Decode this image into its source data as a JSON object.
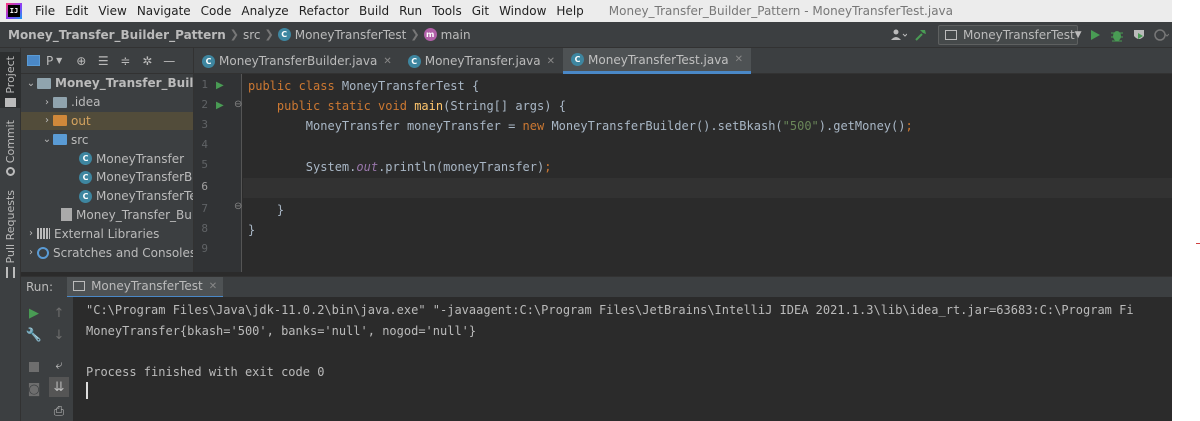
{
  "menubar": {
    "items": [
      "File",
      "Edit",
      "View",
      "Navigate",
      "Code",
      "Analyze",
      "Refactor",
      "Build",
      "Run",
      "Tools",
      "Git",
      "Window",
      "Help"
    ],
    "title": "Money_Transfer_Builder_Pattern - MoneyTransferTest.java"
  },
  "navbar": {
    "project": "Money_Transfer_Builder_Pattern",
    "folder": "src",
    "class": "MoneyTransferTest",
    "method": "main",
    "run_config": "MoneyTransferTest"
  },
  "toolstrip": {
    "project": "Project",
    "commit": "Commit",
    "pull_requests": "Pull Requests"
  },
  "project_panel": {
    "toolbar_label": "P",
    "tree": [
      {
        "label": "Money_Transfer_Builder_P",
        "kind": "project"
      },
      {
        "label": ".idea",
        "kind": "folder"
      },
      {
        "label": "out",
        "kind": "folder-excluded"
      },
      {
        "label": "src",
        "kind": "source-folder"
      },
      {
        "label": "MoneyTransfer",
        "kind": "class"
      },
      {
        "label": "MoneyTransferBuild",
        "kind": "class"
      },
      {
        "label": "MoneyTransferTest",
        "kind": "class"
      },
      {
        "label": "Money_Transfer_Builder",
        "kind": "iml"
      },
      {
        "label": "External Libraries",
        "kind": "libraries"
      },
      {
        "label": "Scratches and Consoles",
        "kind": "scratches"
      }
    ]
  },
  "editor_tabs": [
    {
      "label": "MoneyTransferBuilder.java"
    },
    {
      "label": "MoneyTransfer.java"
    },
    {
      "label": "MoneyTransferTest.java",
      "active": true
    }
  ],
  "editor": {
    "line_numbers": [
      "1",
      "2",
      "3",
      "4",
      "5",
      "6",
      "7",
      "8",
      "9"
    ],
    "current_line": 6,
    "code": {
      "l1": {
        "kw": "public class ",
        "name": "MoneyTransferTest {"
      },
      "l2": {
        "kw": "public static void ",
        "fn": "main",
        "rest": "(String[] args) {"
      },
      "l3": {
        "type": "MoneyTransfer moneyTransfer = ",
        "kw": "new ",
        "call": "MoneyTransferBuilder().setBkash(",
        "str": "\"500\"",
        "end": ").getMoney()",
        "semi": ";"
      },
      "l5": {
        "pre": "System.",
        "fld": "out",
        "post": ".println(moneyTransfer)",
        "semi": ";"
      },
      "l7": "}",
      "l8": "}"
    }
  },
  "run_panel": {
    "label": "Run:",
    "tab": "MoneyTransferTest",
    "output": [
      "\"C:\\Program Files\\Java\\jdk-11.0.2\\bin\\java.exe\" \"-javaagent:C:\\Program Files\\JetBrains\\IntelliJ IDEA 2021.1.3\\lib\\idea_rt.jar=63683:C:\\Program Fi",
      "MoneyTransfer{bkash='500', banks='null', nogod='null'}",
      "",
      "Process finished with exit code 0"
    ]
  },
  "colors": {
    "background": "#2b2b2b",
    "panel": "#3c3f41",
    "keyword": "#cc7832",
    "function": "#ffc66d",
    "string": "#6a8759",
    "field": "#9876aa",
    "accent": "#4a88c7",
    "run_green": "#499c54"
  }
}
